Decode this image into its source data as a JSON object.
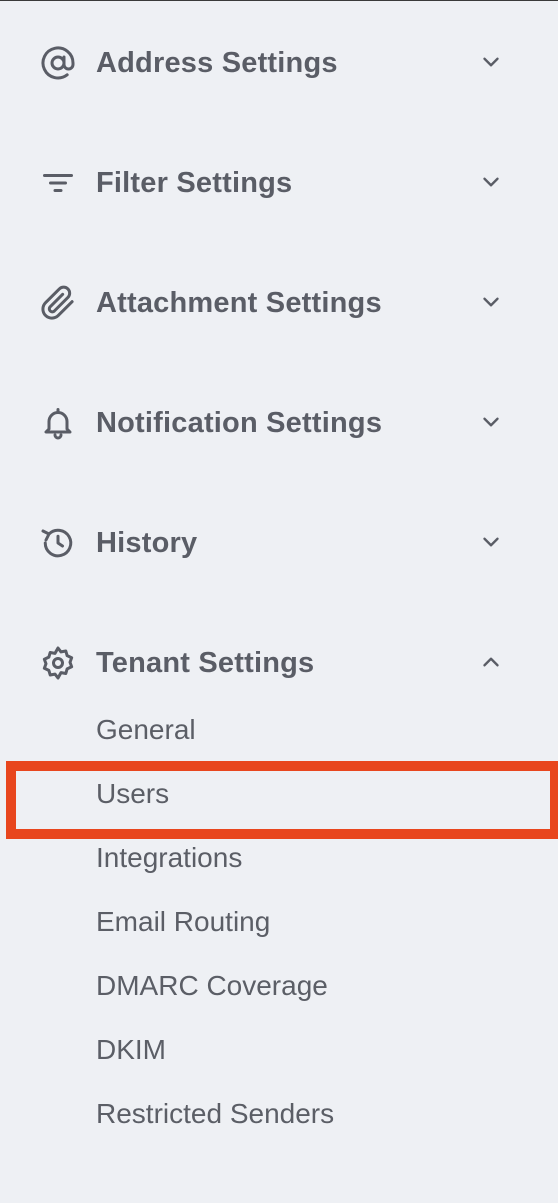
{
  "sections": [
    {
      "label": "Address Settings",
      "icon": "at-sign-icon",
      "expanded": false
    },
    {
      "label": "Filter Settings",
      "icon": "filter-icon",
      "expanded": false
    },
    {
      "label": "Attachment Settings",
      "icon": "paperclip-icon",
      "expanded": false
    },
    {
      "label": "Notification Settings",
      "icon": "bell-icon",
      "expanded": false
    },
    {
      "label": "History",
      "icon": "history-icon",
      "expanded": false
    },
    {
      "label": "Tenant Settings",
      "icon": "gear-icon",
      "expanded": true
    }
  ],
  "tenant_items": [
    {
      "label": "General"
    },
    {
      "label": "Users",
      "highlighted": true
    },
    {
      "label": "Integrations"
    },
    {
      "label": "Email Routing"
    },
    {
      "label": "DMARC Coverage"
    },
    {
      "label": "DKIM"
    },
    {
      "label": "Restricted Senders"
    }
  ],
  "colors": {
    "background": "#eef0f4",
    "text": "#5a5d66",
    "highlight_border": "#e8461e"
  }
}
